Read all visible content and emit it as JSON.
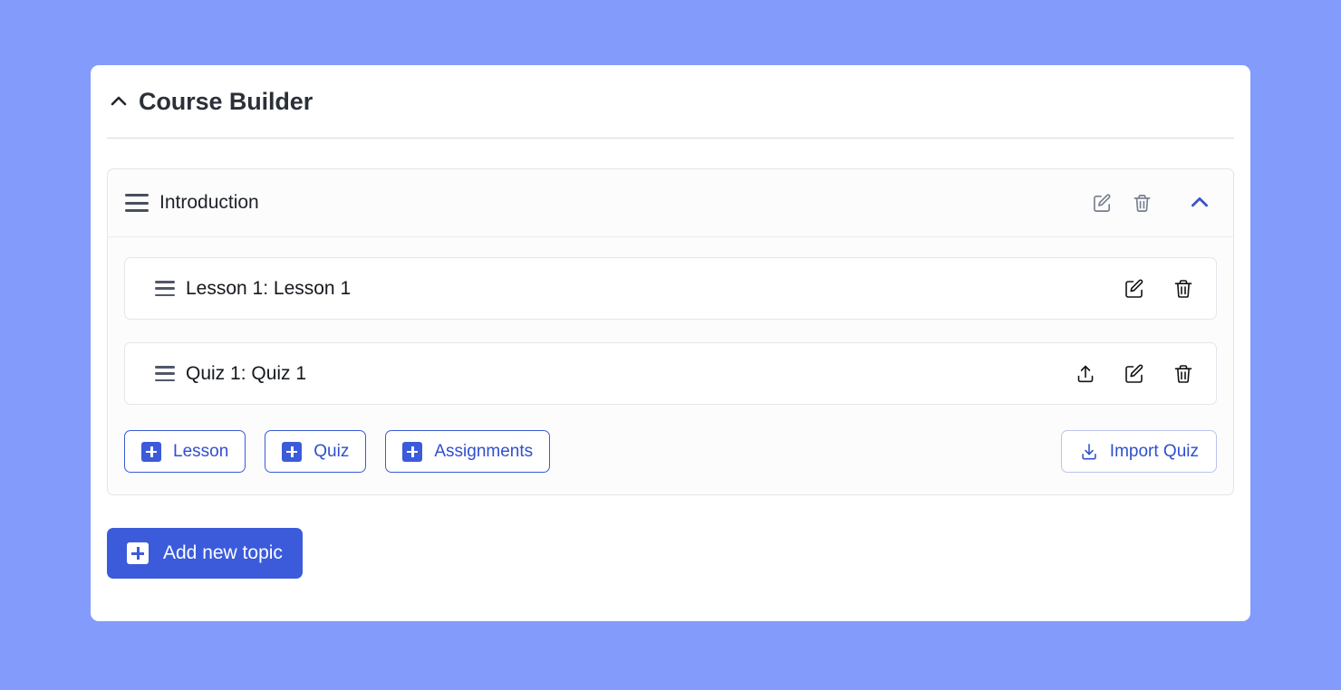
{
  "page": {
    "background_color": "#839bfa"
  },
  "card": {
    "title": "Course Builder",
    "collapse_icon": "chevron-up-icon",
    "accent_color": "#3b5bdb"
  },
  "topic": {
    "drag_icon": "drag-handle-icon",
    "title": "Introduction",
    "edit_icon": "edit-square-icon",
    "delete_icon": "trash-icon",
    "collapse_icon": "chevron-up-icon",
    "collapse_color": "#3b55c4",
    "contents": [
      {
        "drag_icon": "drag-handle-icon",
        "title": "Lesson 1: Lesson 1",
        "actions": [
          "edit-square-icon",
          "trash-icon"
        ]
      },
      {
        "drag_icon": "drag-handle-icon",
        "title": "Quiz 1: Quiz 1",
        "actions": [
          "upload-export-icon",
          "edit-square-icon",
          "trash-icon"
        ]
      }
    ],
    "actions": [
      {
        "label": "Lesson",
        "icon": "plus-square-icon"
      },
      {
        "label": "Quiz",
        "icon": "plus-square-icon"
      },
      {
        "label": "Assignments",
        "icon": "plus-square-icon"
      }
    ],
    "import_button": {
      "label": "Import Quiz",
      "icon": "download-icon"
    }
  },
  "footer": {
    "add_topic": {
      "label": "Add new topic",
      "icon": "plus-square-icon"
    }
  }
}
